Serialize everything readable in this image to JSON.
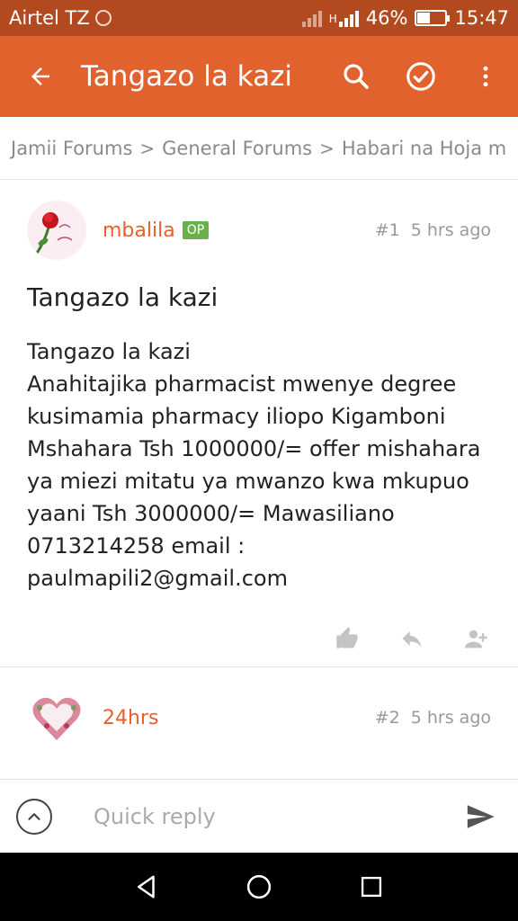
{
  "status_bar": {
    "carrier": "Airtel TZ",
    "network_label": "H",
    "battery_percent_text": "46%",
    "battery_level": 0.46,
    "time": "15:47"
  },
  "app_bar": {
    "title": "Tangazo la kazi",
    "icons": [
      "back-arrow-icon",
      "search-icon",
      "check-circle-icon",
      "more-vert-icon"
    ]
  },
  "breadcrumb": {
    "items": [
      "Jamii Forums",
      "General Forums",
      "Habari na Hoja m"
    ],
    "separator": ">"
  },
  "posts": [
    {
      "username": "mbalila",
      "badge": "OP",
      "number": "#1",
      "time": "5 hrs ago",
      "title": "Tangazo la kazi",
      "body": "Tangazo la kazi\nAnahitajika pharmacist mwenye degree kusimamia pharmacy iliopo Kigamboni Mshahara Tsh 1000000/= offer mishahara ya miezi mitatu ya mwanzo kwa mkupuo yaani Tsh 3000000/= Mawasiliano 0713214258 email : paulmapili2@gmail.com",
      "actions": [
        "like-icon",
        "reply-icon",
        "follow-user-icon"
      ]
    },
    {
      "username": "24hrs",
      "number": "#2",
      "time": "5 hrs ago"
    }
  ],
  "reply_bar": {
    "placeholder": "Quick reply"
  },
  "colors": {
    "accent": "#e2622d",
    "status_bar": "#b34a1f",
    "op_badge": "#6ab04c"
  }
}
